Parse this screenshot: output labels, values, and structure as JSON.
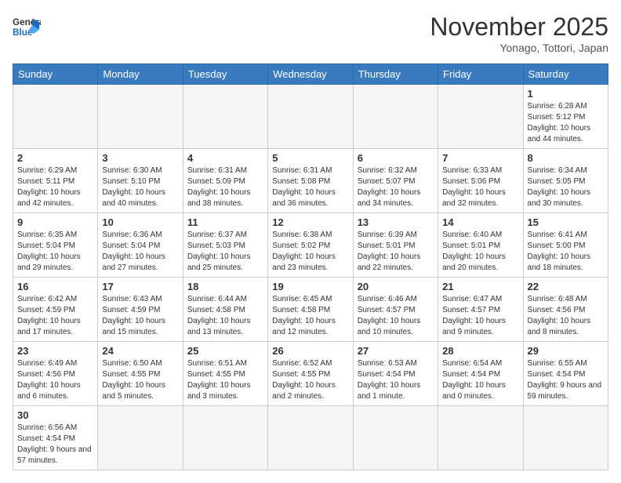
{
  "header": {
    "logo_general": "General",
    "logo_blue": "Blue",
    "month_title": "November 2025",
    "subtitle": "Yonago, Tottori, Japan"
  },
  "weekdays": [
    "Sunday",
    "Monday",
    "Tuesday",
    "Wednesday",
    "Thursday",
    "Friday",
    "Saturday"
  ],
  "weeks": [
    [
      {
        "day": "",
        "info": ""
      },
      {
        "day": "",
        "info": ""
      },
      {
        "day": "",
        "info": ""
      },
      {
        "day": "",
        "info": ""
      },
      {
        "day": "",
        "info": ""
      },
      {
        "day": "",
        "info": ""
      },
      {
        "day": "1",
        "info": "Sunrise: 6:28 AM\nSunset: 5:12 PM\nDaylight: 10 hours and 44 minutes."
      }
    ],
    [
      {
        "day": "2",
        "info": "Sunrise: 6:29 AM\nSunset: 5:11 PM\nDaylight: 10 hours and 42 minutes."
      },
      {
        "day": "3",
        "info": "Sunrise: 6:30 AM\nSunset: 5:10 PM\nDaylight: 10 hours and 40 minutes."
      },
      {
        "day": "4",
        "info": "Sunrise: 6:31 AM\nSunset: 5:09 PM\nDaylight: 10 hours and 38 minutes."
      },
      {
        "day": "5",
        "info": "Sunrise: 6:31 AM\nSunset: 5:08 PM\nDaylight: 10 hours and 36 minutes."
      },
      {
        "day": "6",
        "info": "Sunrise: 6:32 AM\nSunset: 5:07 PM\nDaylight: 10 hours and 34 minutes."
      },
      {
        "day": "7",
        "info": "Sunrise: 6:33 AM\nSunset: 5:06 PM\nDaylight: 10 hours and 32 minutes."
      },
      {
        "day": "8",
        "info": "Sunrise: 6:34 AM\nSunset: 5:05 PM\nDaylight: 10 hours and 30 minutes."
      }
    ],
    [
      {
        "day": "9",
        "info": "Sunrise: 6:35 AM\nSunset: 5:04 PM\nDaylight: 10 hours and 29 minutes."
      },
      {
        "day": "10",
        "info": "Sunrise: 6:36 AM\nSunset: 5:04 PM\nDaylight: 10 hours and 27 minutes."
      },
      {
        "day": "11",
        "info": "Sunrise: 6:37 AM\nSunset: 5:03 PM\nDaylight: 10 hours and 25 minutes."
      },
      {
        "day": "12",
        "info": "Sunrise: 6:38 AM\nSunset: 5:02 PM\nDaylight: 10 hours and 23 minutes."
      },
      {
        "day": "13",
        "info": "Sunrise: 6:39 AM\nSunset: 5:01 PM\nDaylight: 10 hours and 22 minutes."
      },
      {
        "day": "14",
        "info": "Sunrise: 6:40 AM\nSunset: 5:01 PM\nDaylight: 10 hours and 20 minutes."
      },
      {
        "day": "15",
        "info": "Sunrise: 6:41 AM\nSunset: 5:00 PM\nDaylight: 10 hours and 18 minutes."
      }
    ],
    [
      {
        "day": "16",
        "info": "Sunrise: 6:42 AM\nSunset: 4:59 PM\nDaylight: 10 hours and 17 minutes."
      },
      {
        "day": "17",
        "info": "Sunrise: 6:43 AM\nSunset: 4:59 PM\nDaylight: 10 hours and 15 minutes."
      },
      {
        "day": "18",
        "info": "Sunrise: 6:44 AM\nSunset: 4:58 PM\nDaylight: 10 hours and 13 minutes."
      },
      {
        "day": "19",
        "info": "Sunrise: 6:45 AM\nSunset: 4:58 PM\nDaylight: 10 hours and 12 minutes."
      },
      {
        "day": "20",
        "info": "Sunrise: 6:46 AM\nSunset: 4:57 PM\nDaylight: 10 hours and 10 minutes."
      },
      {
        "day": "21",
        "info": "Sunrise: 6:47 AM\nSunset: 4:57 PM\nDaylight: 10 hours and 9 minutes."
      },
      {
        "day": "22",
        "info": "Sunrise: 6:48 AM\nSunset: 4:56 PM\nDaylight: 10 hours and 8 minutes."
      }
    ],
    [
      {
        "day": "23",
        "info": "Sunrise: 6:49 AM\nSunset: 4:56 PM\nDaylight: 10 hours and 6 minutes."
      },
      {
        "day": "24",
        "info": "Sunrise: 6:50 AM\nSunset: 4:55 PM\nDaylight: 10 hours and 5 minutes."
      },
      {
        "day": "25",
        "info": "Sunrise: 6:51 AM\nSunset: 4:55 PM\nDaylight: 10 hours and 3 minutes."
      },
      {
        "day": "26",
        "info": "Sunrise: 6:52 AM\nSunset: 4:55 PM\nDaylight: 10 hours and 2 minutes."
      },
      {
        "day": "27",
        "info": "Sunrise: 6:53 AM\nSunset: 4:54 PM\nDaylight: 10 hours and 1 minute."
      },
      {
        "day": "28",
        "info": "Sunrise: 6:54 AM\nSunset: 4:54 PM\nDaylight: 10 hours and 0 minutes."
      },
      {
        "day": "29",
        "info": "Sunrise: 6:55 AM\nSunset: 4:54 PM\nDaylight: 9 hours and 59 minutes."
      }
    ],
    [
      {
        "day": "30",
        "info": "Sunrise: 6:56 AM\nSunset: 4:54 PM\nDaylight: 9 hours and 57 minutes."
      },
      {
        "day": "",
        "info": ""
      },
      {
        "day": "",
        "info": ""
      },
      {
        "day": "",
        "info": ""
      },
      {
        "day": "",
        "info": ""
      },
      {
        "day": "",
        "info": ""
      },
      {
        "day": "",
        "info": ""
      }
    ]
  ]
}
